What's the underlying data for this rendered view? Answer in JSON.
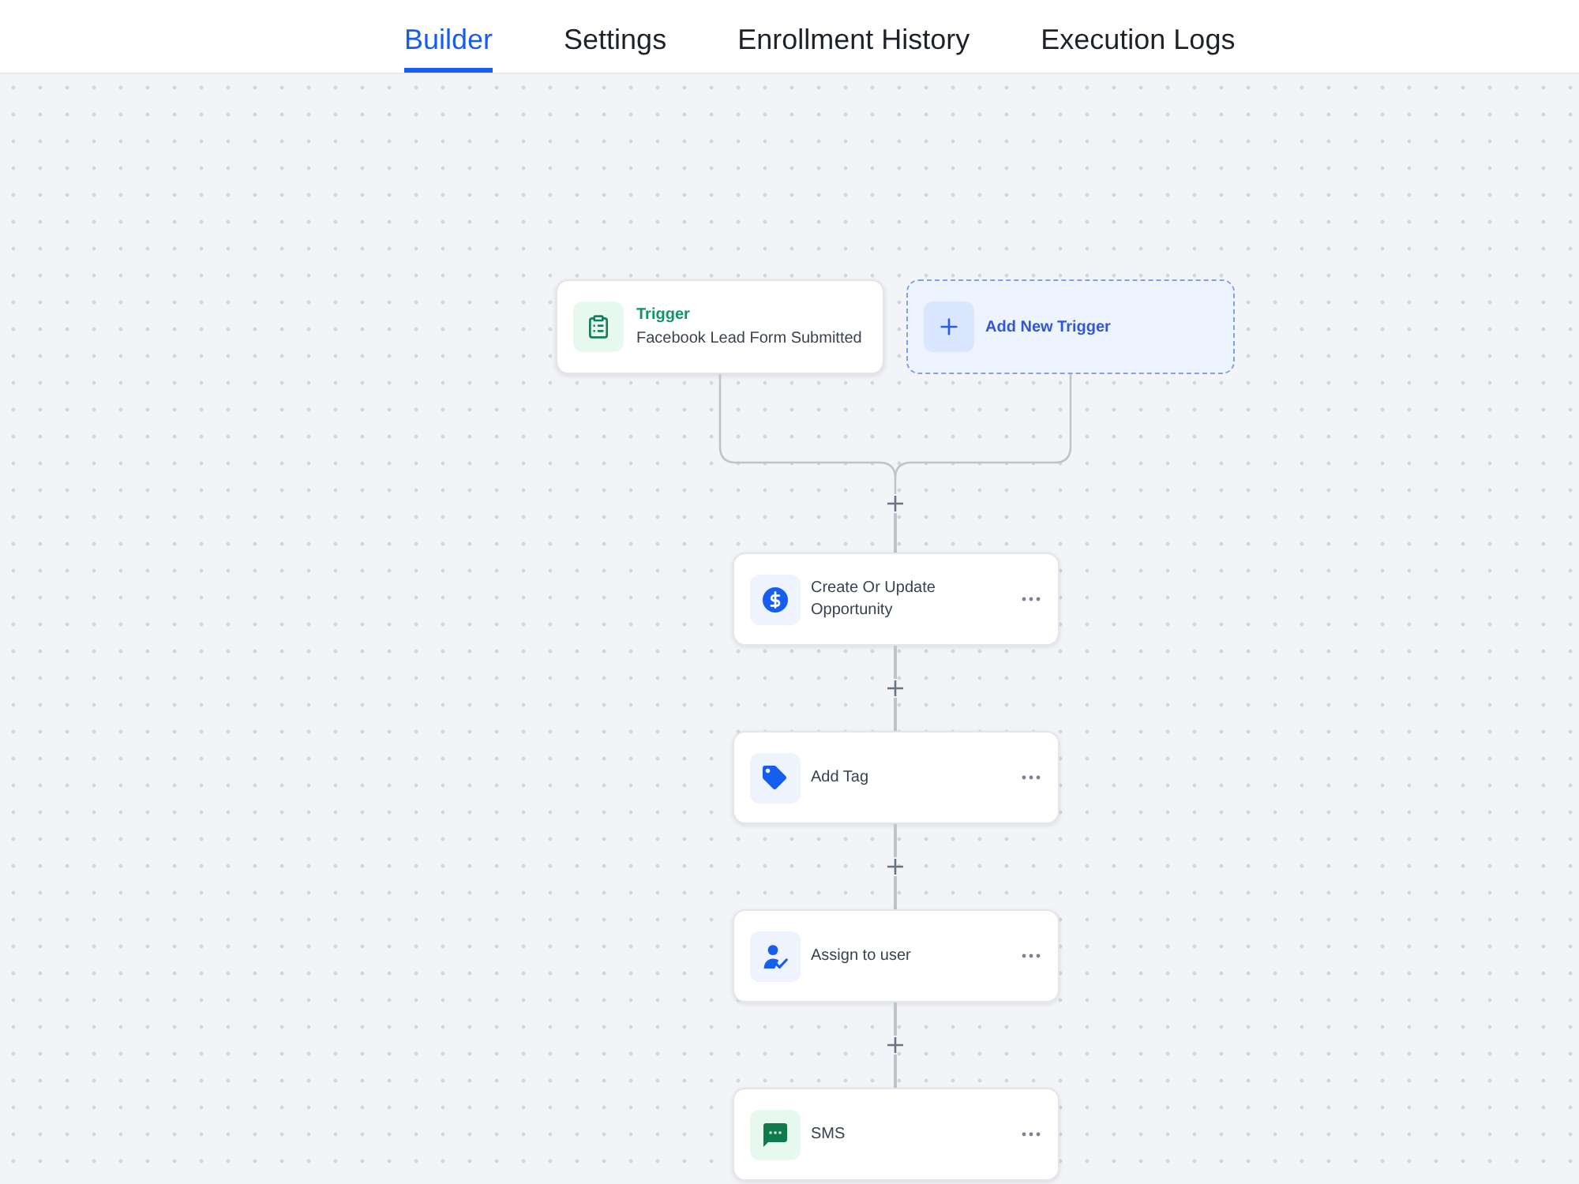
{
  "tabs": [
    {
      "label": "Builder",
      "selected": true
    },
    {
      "label": "Settings",
      "selected": false
    },
    {
      "label": "Enrollment History",
      "selected": false
    },
    {
      "label": "Execution Logs",
      "selected": false
    }
  ],
  "trigger": {
    "title": "Trigger",
    "label": "Facebook Lead Form Submitted"
  },
  "add_trigger": {
    "label": "Add New Trigger"
  },
  "actions": [
    {
      "kind": "opportunity",
      "label": "Create Or Update Opportunity"
    },
    {
      "kind": "tag",
      "label": "Add Tag"
    },
    {
      "kind": "assign",
      "label": "Assign to user"
    },
    {
      "kind": "sms",
      "label": "SMS"
    }
  ]
}
